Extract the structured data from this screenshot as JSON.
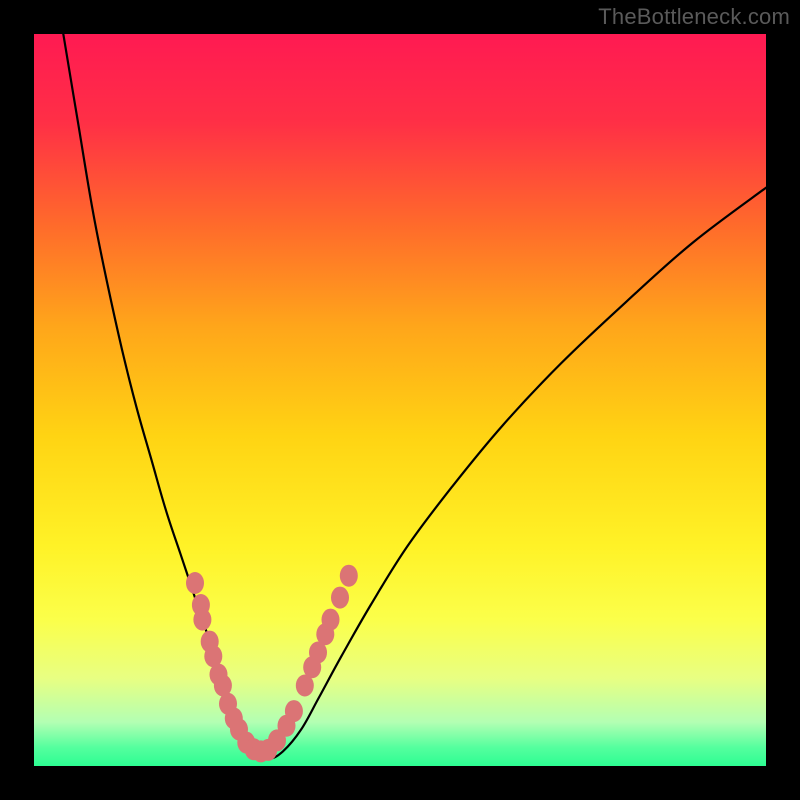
{
  "watermark": {
    "text": "TheBottleneck.com"
  },
  "gradient": {
    "stops": [
      {
        "offset": 0.0,
        "color": "#ff1a52"
      },
      {
        "offset": 0.12,
        "color": "#ff2f46"
      },
      {
        "offset": 0.26,
        "color": "#ff6a2b"
      },
      {
        "offset": 0.4,
        "color": "#ffa61a"
      },
      {
        "offset": 0.55,
        "color": "#ffd413"
      },
      {
        "offset": 0.7,
        "color": "#fff227"
      },
      {
        "offset": 0.8,
        "color": "#fbff4a"
      },
      {
        "offset": 0.88,
        "color": "#e8ff82"
      },
      {
        "offset": 0.94,
        "color": "#b3ffb3"
      },
      {
        "offset": 0.975,
        "color": "#54ff9e"
      },
      {
        "offset": 1.0,
        "color": "#2dfd92"
      }
    ]
  },
  "chart_data": {
    "type": "line",
    "title": "",
    "xlabel": "",
    "ylabel": "",
    "xlim": [
      0,
      100
    ],
    "ylim": [
      0,
      100
    ],
    "background": "heat-gradient (red=high bottleneck, green=low)",
    "series": [
      {
        "name": "bottleneck-curve",
        "x": [
          4,
          6,
          8,
          10,
          12,
          14,
          16,
          18,
          20,
          22,
          24,
          25.5,
          27,
          28.5,
          30,
          32,
          34,
          36.5,
          39,
          42,
          46,
          51,
          57,
          64,
          72,
          81,
          90,
          100
        ],
        "y": [
          100,
          88,
          76,
          66,
          57,
          49,
          42,
          35,
          29,
          23,
          17,
          12,
          8,
          4.5,
          2,
          1,
          2,
          5,
          9.5,
          15,
          22,
          30,
          38,
          46.5,
          55,
          63.5,
          71.5,
          79
        ]
      }
    ],
    "markers": {
      "name": "highlight-dots",
      "color": "#db7475",
      "points": [
        {
          "x": 22.0,
          "y": 25.0
        },
        {
          "x": 22.8,
          "y": 22.0
        },
        {
          "x": 23.0,
          "y": 20.0
        },
        {
          "x": 24.0,
          "y": 17.0
        },
        {
          "x": 24.5,
          "y": 15.0
        },
        {
          "x": 25.2,
          "y": 12.5
        },
        {
          "x": 25.8,
          "y": 11.0
        },
        {
          "x": 26.5,
          "y": 8.5
        },
        {
          "x": 27.3,
          "y": 6.5
        },
        {
          "x": 28.0,
          "y": 5.0
        },
        {
          "x": 29.0,
          "y": 3.2
        },
        {
          "x": 30.0,
          "y": 2.3
        },
        {
          "x": 31.0,
          "y": 2.0
        },
        {
          "x": 32.0,
          "y": 2.2
        },
        {
          "x": 33.2,
          "y": 3.5
        },
        {
          "x": 34.5,
          "y": 5.5
        },
        {
          "x": 35.5,
          "y": 7.5
        },
        {
          "x": 37.0,
          "y": 11.0
        },
        {
          "x": 38.0,
          "y": 13.5
        },
        {
          "x": 38.8,
          "y": 15.5
        },
        {
          "x": 39.8,
          "y": 18.0
        },
        {
          "x": 40.5,
          "y": 20.0
        },
        {
          "x": 41.8,
          "y": 23.0
        },
        {
          "x": 43.0,
          "y": 26.0
        }
      ]
    }
  }
}
